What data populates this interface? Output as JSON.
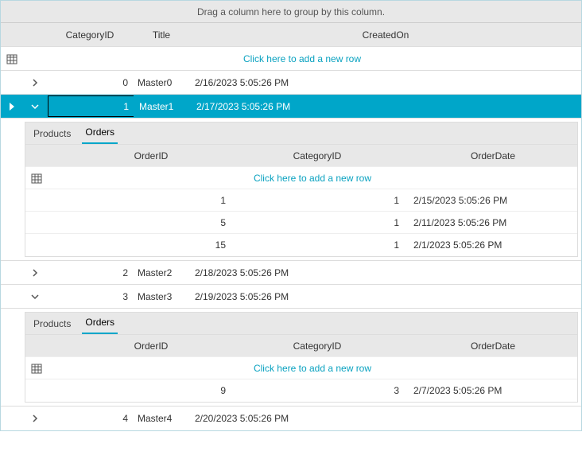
{
  "labels": {
    "groupPanel": "Drag a column here to group by this column.",
    "addRow": "Click here to add a new row"
  },
  "columns": {
    "categoryId": "CategoryID",
    "title": "Title",
    "createdOn": "CreatedOn"
  },
  "nestedColumns": {
    "orderId": "OrderID",
    "categoryId": "CategoryID",
    "orderDate": "OrderDate"
  },
  "tabs": {
    "products": "Products",
    "orders": "Orders"
  },
  "rows": {
    "r0": {
      "categoryId": "0",
      "title": "Master0",
      "createdOn": "2/16/2023 5:05:26 PM"
    },
    "r1": {
      "categoryId": "1",
      "title": "Master1",
      "createdOn": "2/17/2023 5:05:26 PM"
    },
    "r2": {
      "categoryId": "2",
      "title": "Master2",
      "createdOn": "2/18/2023 5:05:26 PM"
    },
    "r3": {
      "categoryId": "3",
      "title": "Master3",
      "createdOn": "2/19/2023 5:05:26 PM"
    },
    "r4": {
      "categoryId": "4",
      "title": "Master4",
      "createdOn": "2/20/2023 5:05:26 PM"
    }
  },
  "nested1": {
    "o0": {
      "orderId": "1",
      "categoryId": "1",
      "orderDate": "2/15/2023 5:05:26 PM"
    },
    "o1": {
      "orderId": "5",
      "categoryId": "1",
      "orderDate": "2/11/2023 5:05:26 PM"
    },
    "o2": {
      "orderId": "15",
      "categoryId": "1",
      "orderDate": "2/1/2023 5:05:26 PM"
    }
  },
  "nested3": {
    "o0": {
      "orderId": "9",
      "categoryId": "3",
      "orderDate": "2/7/2023 5:05:26 PM"
    }
  }
}
